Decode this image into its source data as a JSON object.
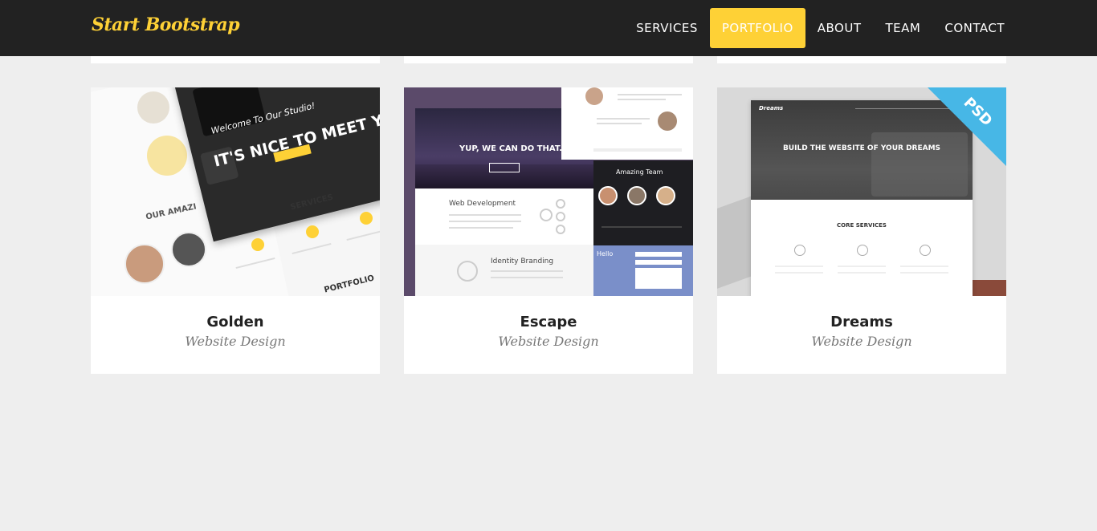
{
  "brand": "Start Bootstrap",
  "nav": {
    "items": [
      {
        "label": "SERVICES",
        "active": false
      },
      {
        "label": "PORTFOLIO",
        "active": true
      },
      {
        "label": "ABOUT",
        "active": false
      },
      {
        "label": "TEAM",
        "active": false
      },
      {
        "label": "CONTACT",
        "active": false
      }
    ]
  },
  "portfolio": [
    {
      "title": "Golden",
      "subtitle": "Website Design",
      "thumb": {
        "welcome": "Welcome To Our Studio!",
        "headline": "IT'S NICE TO MEET YOU",
        "services": "SERVICES",
        "amazing": "OUR AMAZI",
        "portfolio": "PORTFOLIO"
      }
    },
    {
      "title": "Escape",
      "subtitle": "Website Design",
      "thumb": {
        "hero": "YUP, WE CAN DO THAT.",
        "web_dev": "Web Development",
        "identity": "Identity Branding",
        "team": "Amazing Team",
        "hello": "Hello"
      }
    },
    {
      "title": "Dreams",
      "subtitle": "Website Design",
      "thumb": {
        "hero": "BUILD THE WEBSITE OF YOUR DREAMS",
        "core": "CORE SERVICES",
        "ribbon": "PSD"
      }
    }
  ],
  "colors": {
    "accent": "#fed136",
    "navbar": "#222222",
    "page_bg": "#eeeeee"
  }
}
